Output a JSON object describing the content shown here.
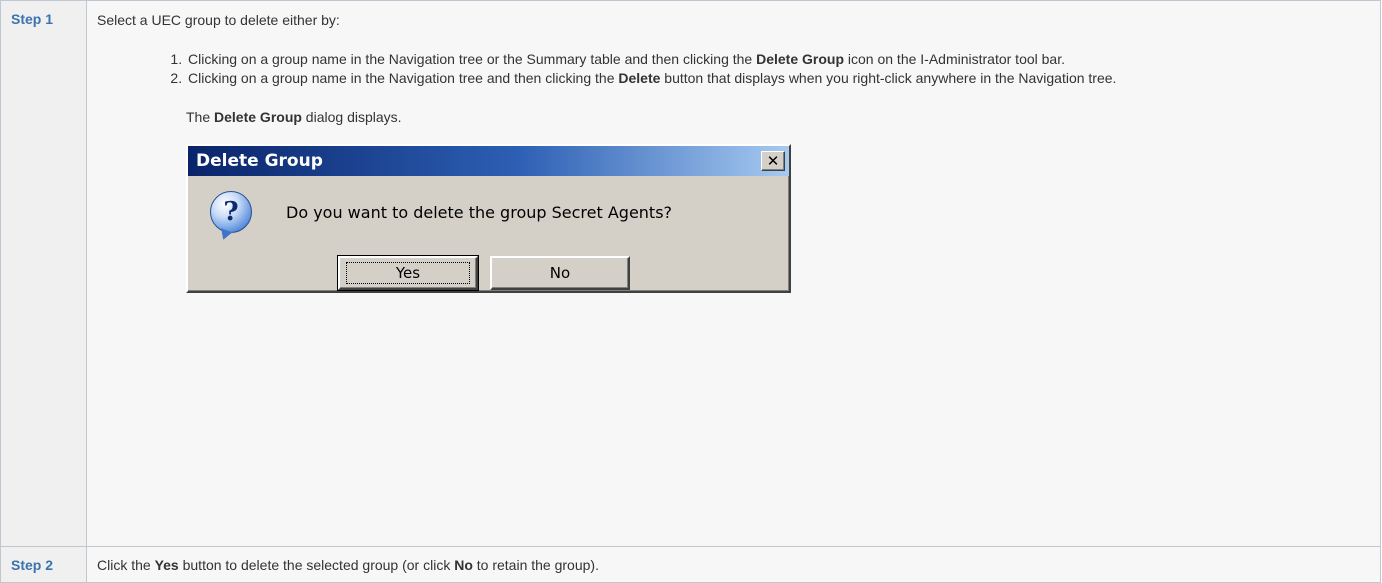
{
  "steps": [
    {
      "label": "Step 1",
      "intro": "Select a UEC group to delete either by:",
      "options": [
        {
          "before": "Clicking on a group name in the Navigation tree or the Summary table and then clicking the ",
          "bold": "Delete Group",
          "after": " icon on the I-Administrator tool bar."
        },
        {
          "before": "Clicking on a group name in the Navigation tree and then clicking the ",
          "bold": "Delete",
          "after": " button that displays when you right-click anywhere in the Navigation tree."
        }
      ],
      "displays": {
        "before": "The ",
        "bold": "Delete Group",
        "after": " dialog displays."
      }
    },
    {
      "label": "Step 2",
      "text": {
        "part1": "Click the ",
        "bold1": "Yes",
        "part2": " button to delete the selected group (or click ",
        "bold2": "No",
        "part3": " to retain the group)."
      }
    }
  ],
  "dialog": {
    "title": "Delete Group",
    "close_glyph": "✕",
    "icon": "question-icon",
    "icon_glyph": "?",
    "message": "Do you want to delete the group Secret Agents?",
    "yes_label": "Yes",
    "no_label": "No"
  },
  "colors": {
    "step_label": "#3b73af",
    "border": "#c1c7d0",
    "titlebar_start": "#0a246a",
    "titlebar_end": "#a6caf0",
    "dialog_face": "#d4d0c8"
  }
}
